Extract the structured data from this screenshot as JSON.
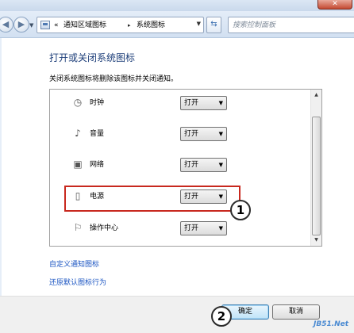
{
  "toolbar": {
    "address_overflow": "«",
    "address_segment1": "通知区域图标",
    "address_separator": "▸",
    "address_segment2": "系统图标",
    "search_placeholder": "搜索控制面板"
  },
  "content": {
    "title": "打开或关闭系统图标",
    "description": "关闭系统图标将删除该图标并关闭通知。",
    "rows": [
      {
        "label": "时钟",
        "icon": "clock-icon",
        "value": "打开"
      },
      {
        "label": "音量",
        "icon": "volume-icon",
        "value": "打开"
      },
      {
        "label": "网络",
        "icon": "network-icon",
        "value": "打开"
      },
      {
        "label": "电源",
        "icon": "power-icon",
        "value": "打开"
      },
      {
        "label": "操作中心",
        "icon": "flag-icon",
        "value": "打开"
      }
    ],
    "links": {
      "customize": "自定义通知图标",
      "restore": "还原默认图标行为"
    }
  },
  "annotations": {
    "badge1": "1",
    "badge2": "2",
    "highlight_color": "#c8281e"
  },
  "footer": {
    "ok_label": "确定",
    "cancel_label": "取消"
  },
  "watermark": "JB51.Net"
}
